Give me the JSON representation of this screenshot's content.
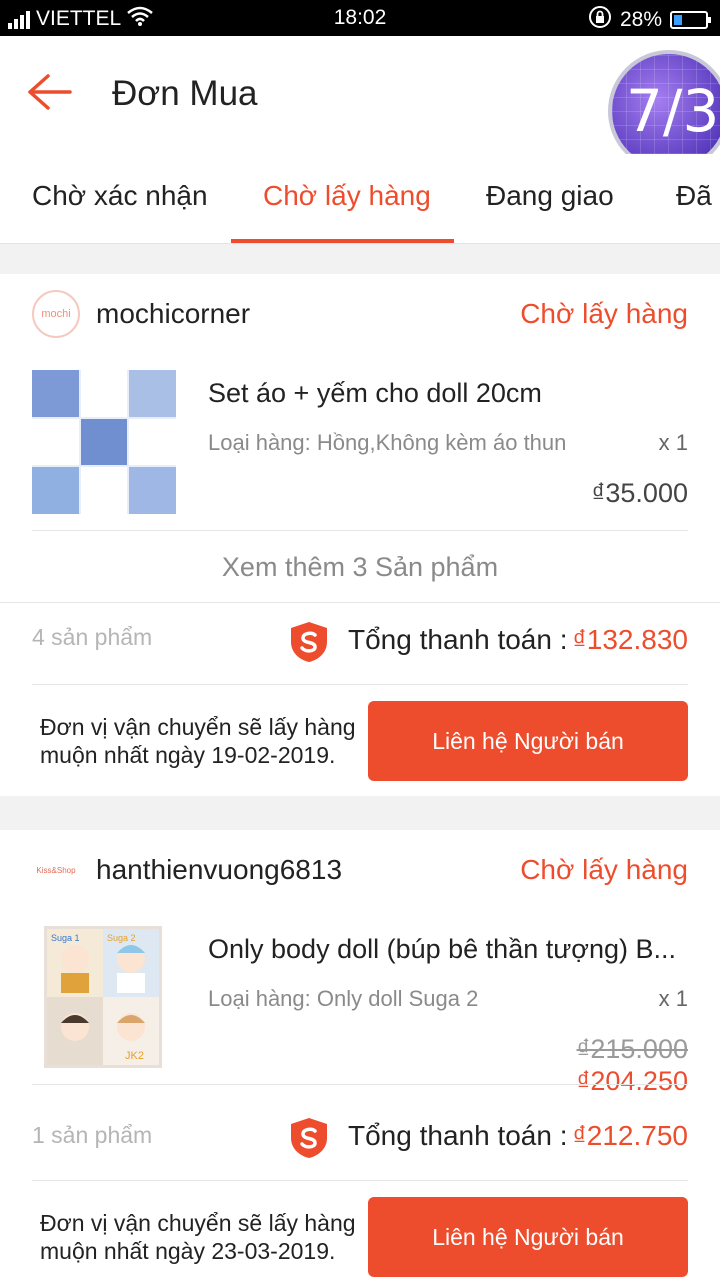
{
  "status_bar": {
    "carrier": "VIETTEL",
    "time": "18:02",
    "battery": "28%",
    "battery_level": 0.28
  },
  "header": {
    "title": "Đơn Mua",
    "badge": "7/3"
  },
  "tabs": [
    {
      "label": "Chờ xác nhận",
      "active": false
    },
    {
      "label": "Chờ lấy hàng",
      "active": true
    },
    {
      "label": "Đang giao",
      "active": false
    },
    {
      "label": "Đã g",
      "active": false
    }
  ],
  "orders": [
    {
      "shop_name": "mochicorner",
      "shop_logo_text": "mochi",
      "status": "Chờ lấy hàng",
      "product_name": "Set áo + yếm cho doll 20cm",
      "variant": "Loại hàng: Hồng,Không kèm áo thun",
      "qty": "x 1",
      "price": "₫35.000",
      "more": "Xem thêm 3 Sản phẩm",
      "count": "4 sản phẩm",
      "total_label": "Tổng thanh toán :",
      "total_value": "₫132.830",
      "ship_note": "Đơn vị vận chuyển sẽ lấy hàng muộn nhất ngày 19-02-2019.",
      "button": "Liên hệ Người bán"
    },
    {
      "shop_name": "hanthienvuong6813",
      "shop_logo_text": "Kiss&Shop",
      "status": "Chờ lấy hàng",
      "product_name": "Only body doll (búp bê thần tượng) B...",
      "variant": "Loại hàng: Only doll Suga 2",
      "qty": "x 1",
      "price_original": "₫215.000",
      "price": "₫204.250",
      "thumb_labels": [
        "Suga 1",
        "Suga 2",
        "JK2"
      ],
      "count": "1 sản phẩm",
      "total_label": "Tổng thanh toán :",
      "total_value": "₫212.750",
      "ship_note": "Đơn vị vận chuyển sẽ lấy hàng muộn nhất ngày 23-03-2019.",
      "button": "Liên hệ Người bán"
    }
  ],
  "colors": {
    "accent": "#ee4d2d",
    "background": "#f2f2f2"
  }
}
